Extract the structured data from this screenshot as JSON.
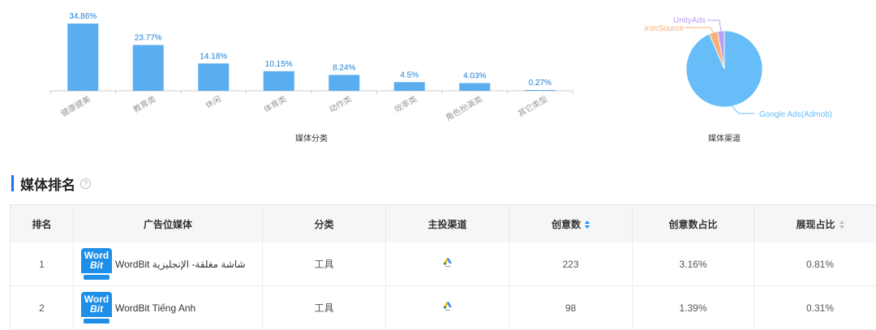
{
  "chart_data": [
    {
      "type": "bar",
      "categories": [
        "健康健美",
        "教育类",
        "休闲",
        "体育类",
        "动作类",
        "效率类",
        "角色扮演类",
        "其它类型"
      ],
      "values": [
        34.86,
        23.77,
        14.18,
        10.15,
        8.24,
        4.5,
        4.03,
        0.27
      ],
      "value_labels": [
        "34.86%",
        "23.77%",
        "14.18%",
        "10.15%",
        "8.24%",
        "4.5%",
        "4.03%",
        "0.27%"
      ],
      "xlabel": "媒体分类",
      "ylim": [
        0,
        37
      ],
      "color": "#5aaef0",
      "grid": false
    },
    {
      "type": "pie",
      "series": [
        {
          "name": "Google Ads(Admob)",
          "value": 93.5,
          "color": "#67bdf8"
        },
        {
          "name": "ironSource",
          "value": 3.7,
          "color": "#f6b07c"
        },
        {
          "name": "UnityAds",
          "value": 2.8,
          "color": "#b89ef0"
        }
      ],
      "xlabel": "媒体渠道"
    }
  ],
  "section": {
    "title": "媒体排名",
    "help_icon": "?"
  },
  "table": {
    "headers": [
      "排名",
      "广告位媒体",
      "分类",
      "主投渠道",
      "创意数",
      "创意数占比",
      "展现占比"
    ],
    "rows": [
      {
        "rank": "1",
        "icon_top": "Word",
        "icon_bottom": "Bit",
        "media": "WordBit شاشة مغلقة- الإنجليزية",
        "category": "工具",
        "channel_icon": "google-ads-icon",
        "creatives": "223",
        "creative_share": "3.16%",
        "impression_share": "0.81%"
      },
      {
        "rank": "2",
        "icon_top": "Word",
        "icon_bottom": "Bit",
        "media": "WordBit Tiếng Anh",
        "category": "工具",
        "channel_icon": "google-ads-icon",
        "creatives": "98",
        "creative_share": "1.39%",
        "impression_share": "0.31%"
      }
    ]
  }
}
